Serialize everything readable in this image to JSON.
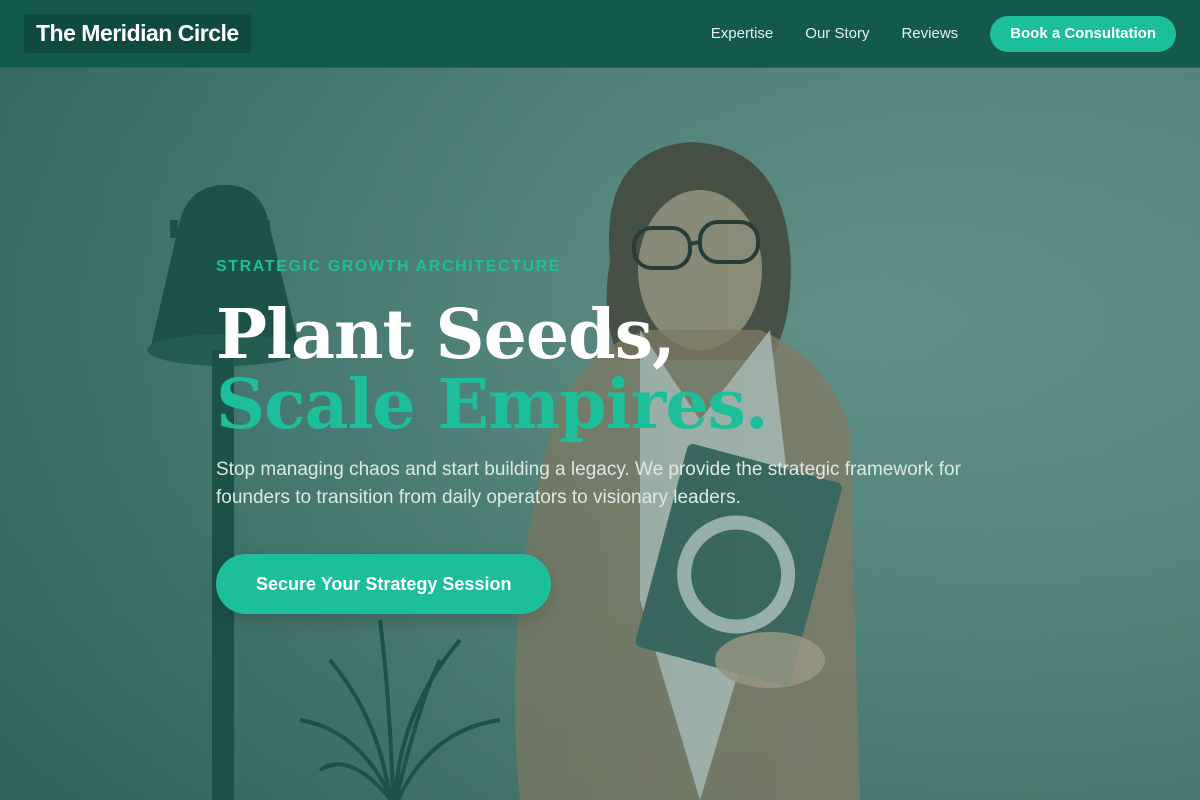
{
  "header": {
    "brand": "The Meridian Circle",
    "nav": [
      {
        "label": "Expertise"
      },
      {
        "label": "Our Story"
      },
      {
        "label": "Reviews"
      }
    ],
    "cta_label": "Book a Consultation"
  },
  "hero": {
    "eyebrow": "STRATEGIC GROWTH ARCHITECTURE",
    "headline_line1": "Plant Seeds,",
    "headline_line2": "Scale Empires.",
    "subheadline": "Stop managing chaos and start building a legacy. We provide the strategic framework for founders to transition from daily operators to visionary leaders.",
    "button_label": "Secure Your Strategy Session"
  },
  "colors": {
    "header_bg": "#135a4d",
    "accent": "#1dbf9a",
    "overlay": "#4f7f77"
  },
  "icons": [
    "floor-lamp-illustration",
    "woman-portrait-illustration",
    "potted-plant-illustration"
  ]
}
